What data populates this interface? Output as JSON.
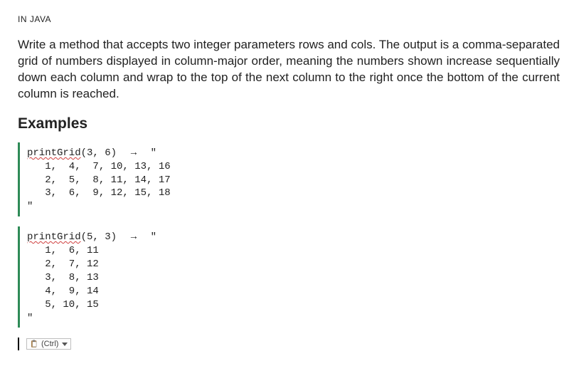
{
  "header": {
    "label": "IN JAVA"
  },
  "prompt": {
    "text": "Write a method that accepts two integer parameters rows and cols. The output is a comma-separated grid of numbers displayed in column-major order, meaning the numbers shown increase sequentially down each column and wrap to the top of the next column to the right once the bottom of the current column is reached."
  },
  "examples": {
    "heading": "Examples",
    "blocks": [
      {
        "call_fn": "printGrid",
        "call_args": "(3, 6)",
        "arrow": "→",
        "opening_quote": "\"",
        "body": "   1,  4,  7, 10, 13, 16\n   2,  5,  8, 11, 14, 17\n   3,  6,  9, 12, 15, 18",
        "closing_quote": "\""
      },
      {
        "call_fn": "printGrid",
        "call_args": "(5, 3)",
        "arrow": "→",
        "opening_quote": "\"",
        "body": "   1,  6, 11\n   2,  7, 12\n   3,  8, 13\n   4,  9, 14\n   5, 10, 15",
        "closing_quote": "\""
      }
    ]
  },
  "paste_tag": {
    "label": "(Ctrl)"
  }
}
